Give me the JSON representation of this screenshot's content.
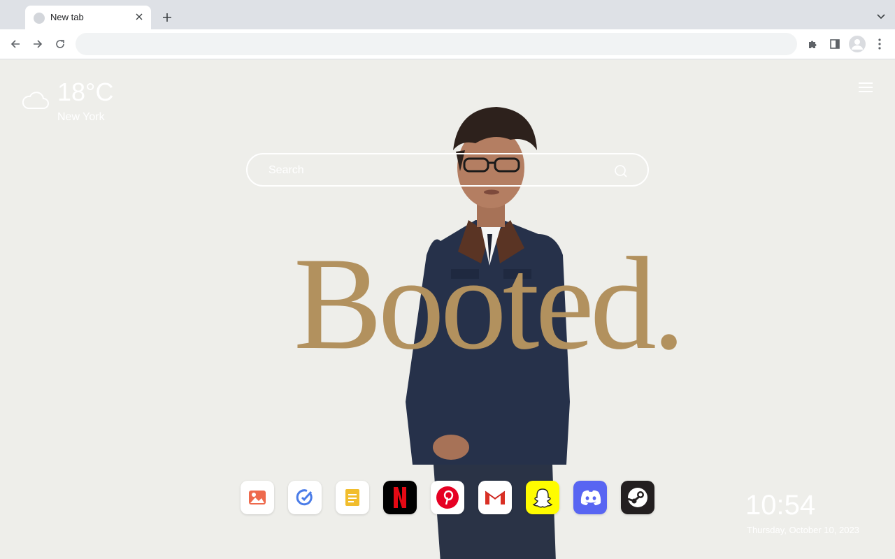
{
  "browser": {
    "tab_title": "New tab",
    "omnibox_value": ""
  },
  "icons": {
    "tab_favicon": "favicon-placeholder-icon",
    "tab_close": "close-icon",
    "new_tab": "plus-icon",
    "tab_search": "chevron-down-icon",
    "back": "arrow-left-icon",
    "forward": "arrow-right-icon",
    "reload": "reload-icon",
    "extensions": "puzzle-icon",
    "side_panel": "side-panel-icon",
    "profile": "profile-avatar-icon",
    "menu": "kebab-menu-icon"
  },
  "weather": {
    "temperature": "18°C",
    "city": "New York",
    "icon": "cloud-icon"
  },
  "search": {
    "placeholder": "Search",
    "icon": "search-icon"
  },
  "headline": "Booted.",
  "dock": [
    {
      "name": "images-app",
      "color": "#ffffff",
      "accent": "#ee6a4d"
    },
    {
      "name": "tasks-app",
      "color": "#ffffff",
      "accent": "#4a7ce8"
    },
    {
      "name": "notes-app",
      "color": "#ffffff",
      "accent": "#f1bd2c"
    },
    {
      "name": "netflix-app",
      "color": "#000000",
      "accent": "#e50914"
    },
    {
      "name": "pinterest-app",
      "color": "#ffffff",
      "accent": "#e60023"
    },
    {
      "name": "gmail-app",
      "color": "#ffffff",
      "accent": "#d93025"
    },
    {
      "name": "snapchat-app",
      "color": "#fffc00",
      "accent": "#ffffff"
    },
    {
      "name": "discord-app",
      "color": "#5865f2",
      "accent": "#ffffff"
    },
    {
      "name": "steam-app",
      "color": "#231f20",
      "accent": "#ffffff"
    }
  ],
  "clock": {
    "time": "10:54",
    "date": "Thursday, October 10, 2023"
  },
  "colors": {
    "page_background": "#eeeeea",
    "headline": "#b2915e",
    "tabstrip": "#dee1e6",
    "omnibox": "#f1f3f4"
  }
}
